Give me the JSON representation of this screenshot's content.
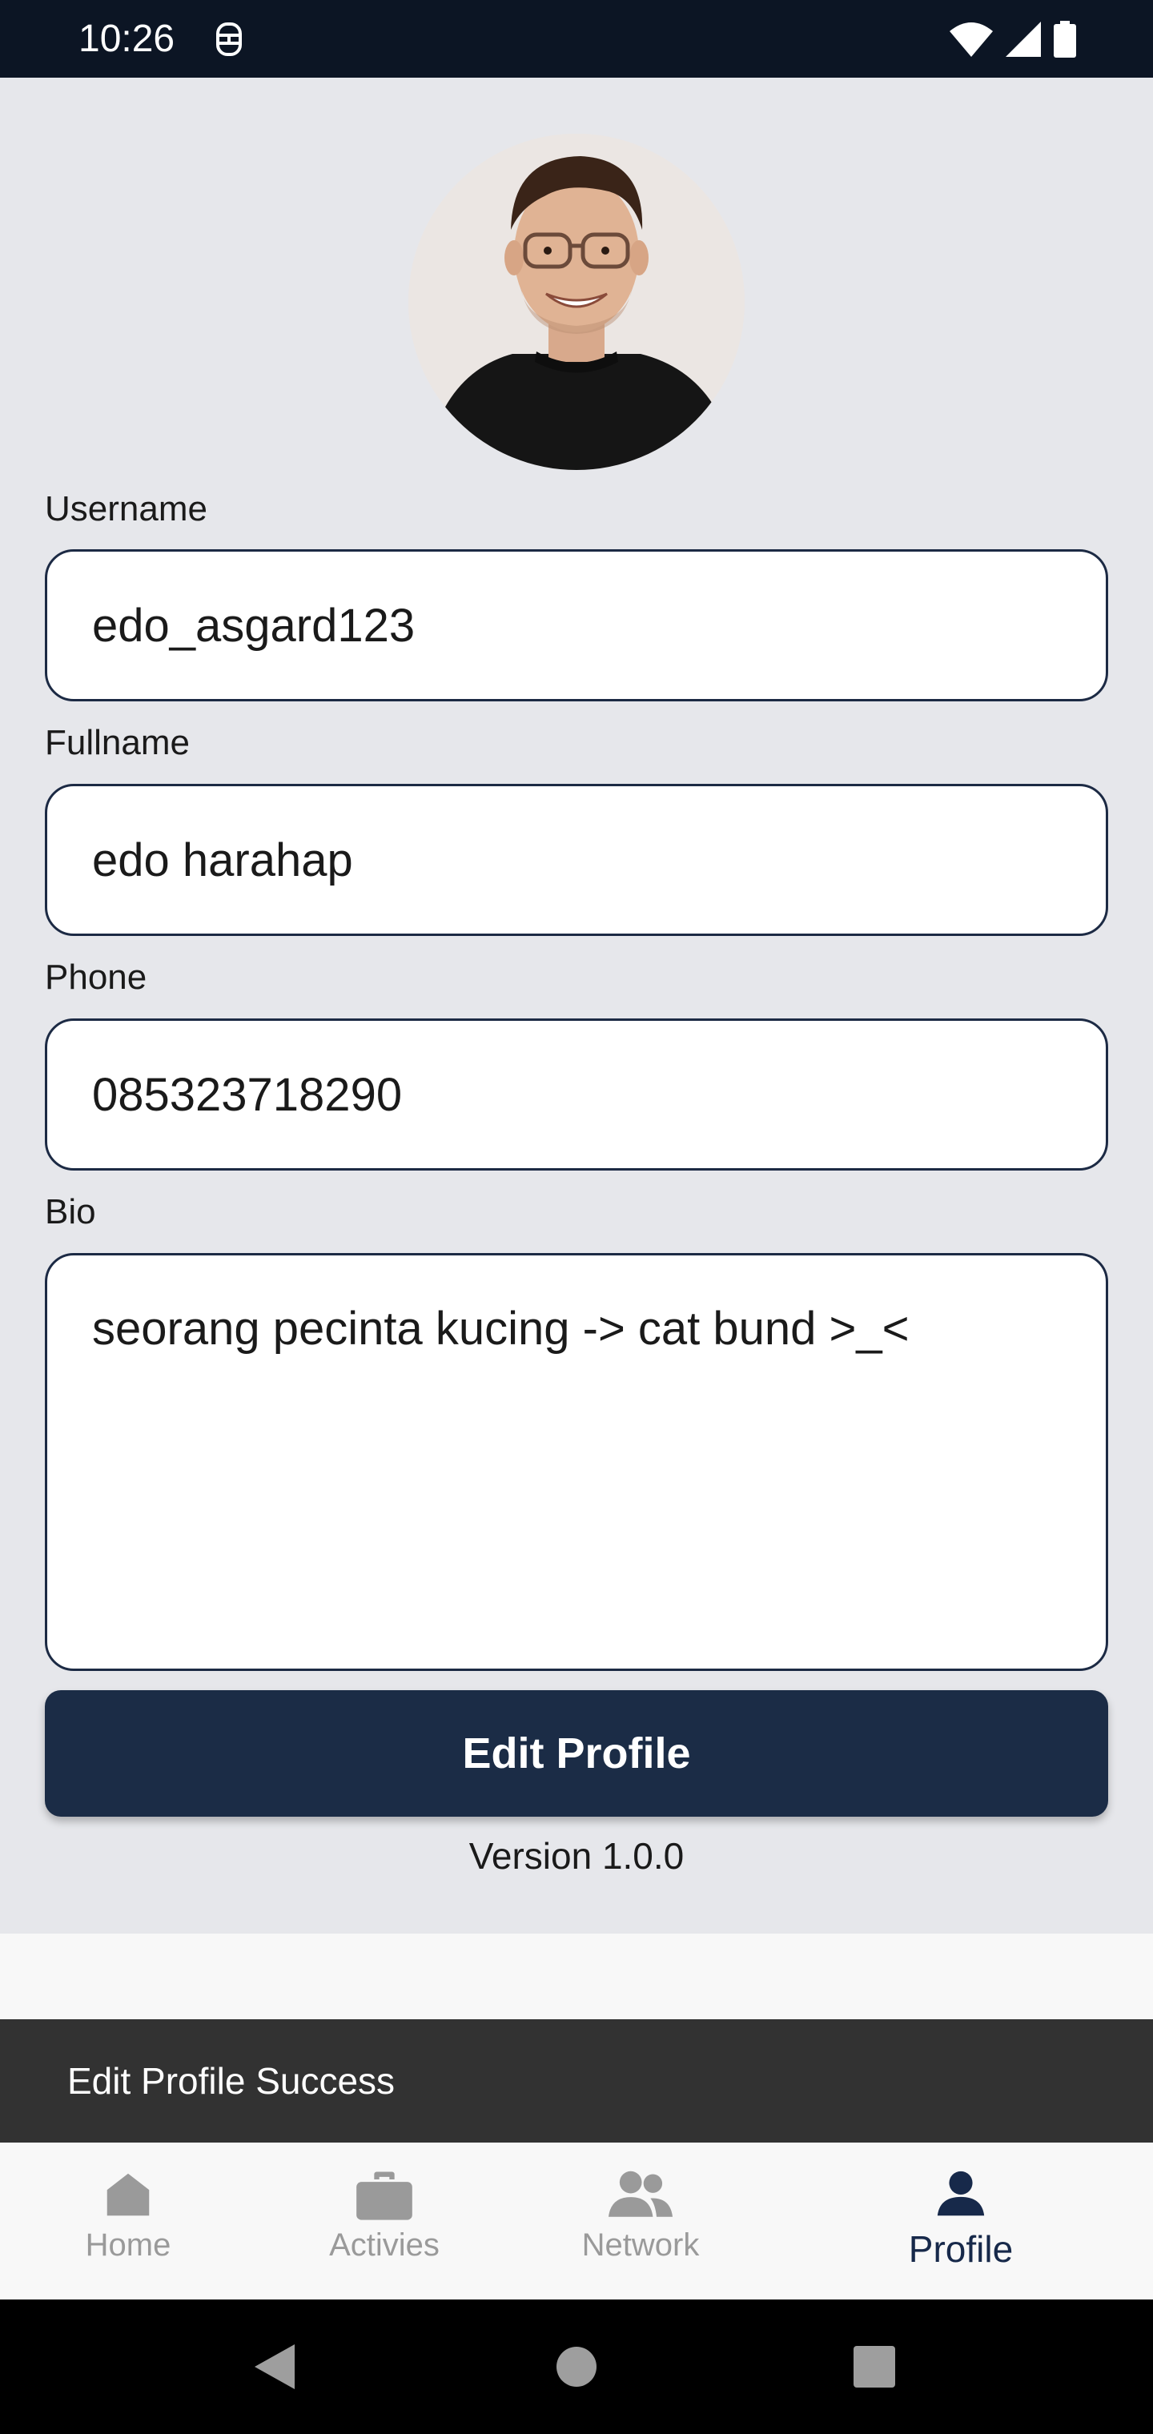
{
  "status_bar": {
    "time": "10:26",
    "app_icon": "accessibility-icon",
    "wifi_icon": "wifi-icon",
    "signal_icon": "signal-icon",
    "battery_icon": "battery-icon"
  },
  "profile": {
    "avatar_icon": "profile-photo",
    "fields": {
      "username": {
        "label": "Username",
        "value": "edo_asgard123"
      },
      "fullname": {
        "label": "Fullname",
        "value": "edo harahap"
      },
      "phone": {
        "label": "Phone",
        "value": "085323718290"
      },
      "bio": {
        "label": "Bio",
        "value": "seorang pecinta kucing -> cat bund >_<"
      }
    },
    "edit_button_label": "Edit Profile",
    "version": "Version 1.0.0"
  },
  "snackbar": {
    "message": "Edit Profile Success"
  },
  "bottom_nav": {
    "items": [
      {
        "label": "Home",
        "icon": "home-icon",
        "active": false
      },
      {
        "label": "Activies",
        "icon": "briefcase-icon",
        "active": false
      },
      {
        "label": "Network",
        "icon": "people-icon",
        "active": false
      },
      {
        "label": "Profile",
        "icon": "person-icon",
        "active": true
      }
    ]
  },
  "colors": {
    "primary": "#1b2c46",
    "background": "#e6e7eb",
    "status_bar": "#0c1524",
    "snackbar": "#323232",
    "inactive_nav": "#9a9a9a"
  },
  "system_nav": {
    "back_icon": "back-icon",
    "home_icon": "home-circle-icon",
    "recents_icon": "recents-icon"
  }
}
